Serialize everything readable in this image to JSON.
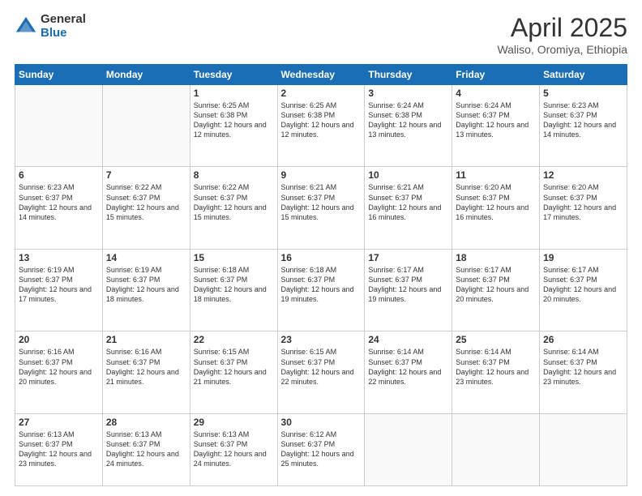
{
  "logo": {
    "general": "General",
    "blue": "Blue"
  },
  "title": {
    "month": "April 2025",
    "location": "Waliso, Oromiya, Ethiopia"
  },
  "weekdays": [
    "Sunday",
    "Monday",
    "Tuesday",
    "Wednesday",
    "Thursday",
    "Friday",
    "Saturday"
  ],
  "weeks": [
    [
      {
        "day": "",
        "info": ""
      },
      {
        "day": "",
        "info": ""
      },
      {
        "day": "1",
        "info": "Sunrise: 6:25 AM\nSunset: 6:38 PM\nDaylight: 12 hours and 12 minutes."
      },
      {
        "day": "2",
        "info": "Sunrise: 6:25 AM\nSunset: 6:38 PM\nDaylight: 12 hours and 12 minutes."
      },
      {
        "day": "3",
        "info": "Sunrise: 6:24 AM\nSunset: 6:38 PM\nDaylight: 12 hours and 13 minutes."
      },
      {
        "day": "4",
        "info": "Sunrise: 6:24 AM\nSunset: 6:37 PM\nDaylight: 12 hours and 13 minutes."
      },
      {
        "day": "5",
        "info": "Sunrise: 6:23 AM\nSunset: 6:37 PM\nDaylight: 12 hours and 14 minutes."
      }
    ],
    [
      {
        "day": "6",
        "info": "Sunrise: 6:23 AM\nSunset: 6:37 PM\nDaylight: 12 hours and 14 minutes."
      },
      {
        "day": "7",
        "info": "Sunrise: 6:22 AM\nSunset: 6:37 PM\nDaylight: 12 hours and 15 minutes."
      },
      {
        "day": "8",
        "info": "Sunrise: 6:22 AM\nSunset: 6:37 PM\nDaylight: 12 hours and 15 minutes."
      },
      {
        "day": "9",
        "info": "Sunrise: 6:21 AM\nSunset: 6:37 PM\nDaylight: 12 hours and 15 minutes."
      },
      {
        "day": "10",
        "info": "Sunrise: 6:21 AM\nSunset: 6:37 PM\nDaylight: 12 hours and 16 minutes."
      },
      {
        "day": "11",
        "info": "Sunrise: 6:20 AM\nSunset: 6:37 PM\nDaylight: 12 hours and 16 minutes."
      },
      {
        "day": "12",
        "info": "Sunrise: 6:20 AM\nSunset: 6:37 PM\nDaylight: 12 hours and 17 minutes."
      }
    ],
    [
      {
        "day": "13",
        "info": "Sunrise: 6:19 AM\nSunset: 6:37 PM\nDaylight: 12 hours and 17 minutes."
      },
      {
        "day": "14",
        "info": "Sunrise: 6:19 AM\nSunset: 6:37 PM\nDaylight: 12 hours and 18 minutes."
      },
      {
        "day": "15",
        "info": "Sunrise: 6:18 AM\nSunset: 6:37 PM\nDaylight: 12 hours and 18 minutes."
      },
      {
        "day": "16",
        "info": "Sunrise: 6:18 AM\nSunset: 6:37 PM\nDaylight: 12 hours and 19 minutes."
      },
      {
        "day": "17",
        "info": "Sunrise: 6:17 AM\nSunset: 6:37 PM\nDaylight: 12 hours and 19 minutes."
      },
      {
        "day": "18",
        "info": "Sunrise: 6:17 AM\nSunset: 6:37 PM\nDaylight: 12 hours and 20 minutes."
      },
      {
        "day": "19",
        "info": "Sunrise: 6:17 AM\nSunset: 6:37 PM\nDaylight: 12 hours and 20 minutes."
      }
    ],
    [
      {
        "day": "20",
        "info": "Sunrise: 6:16 AM\nSunset: 6:37 PM\nDaylight: 12 hours and 20 minutes."
      },
      {
        "day": "21",
        "info": "Sunrise: 6:16 AM\nSunset: 6:37 PM\nDaylight: 12 hours and 21 minutes."
      },
      {
        "day": "22",
        "info": "Sunrise: 6:15 AM\nSunset: 6:37 PM\nDaylight: 12 hours and 21 minutes."
      },
      {
        "day": "23",
        "info": "Sunrise: 6:15 AM\nSunset: 6:37 PM\nDaylight: 12 hours and 22 minutes."
      },
      {
        "day": "24",
        "info": "Sunrise: 6:14 AM\nSunset: 6:37 PM\nDaylight: 12 hours and 22 minutes."
      },
      {
        "day": "25",
        "info": "Sunrise: 6:14 AM\nSunset: 6:37 PM\nDaylight: 12 hours and 23 minutes."
      },
      {
        "day": "26",
        "info": "Sunrise: 6:14 AM\nSunset: 6:37 PM\nDaylight: 12 hours and 23 minutes."
      }
    ],
    [
      {
        "day": "27",
        "info": "Sunrise: 6:13 AM\nSunset: 6:37 PM\nDaylight: 12 hours and 23 minutes."
      },
      {
        "day": "28",
        "info": "Sunrise: 6:13 AM\nSunset: 6:37 PM\nDaylight: 12 hours and 24 minutes."
      },
      {
        "day": "29",
        "info": "Sunrise: 6:13 AM\nSunset: 6:37 PM\nDaylight: 12 hours and 24 minutes."
      },
      {
        "day": "30",
        "info": "Sunrise: 6:12 AM\nSunset: 6:37 PM\nDaylight: 12 hours and 25 minutes."
      },
      {
        "day": "",
        "info": ""
      },
      {
        "day": "",
        "info": ""
      },
      {
        "day": "",
        "info": ""
      }
    ]
  ]
}
